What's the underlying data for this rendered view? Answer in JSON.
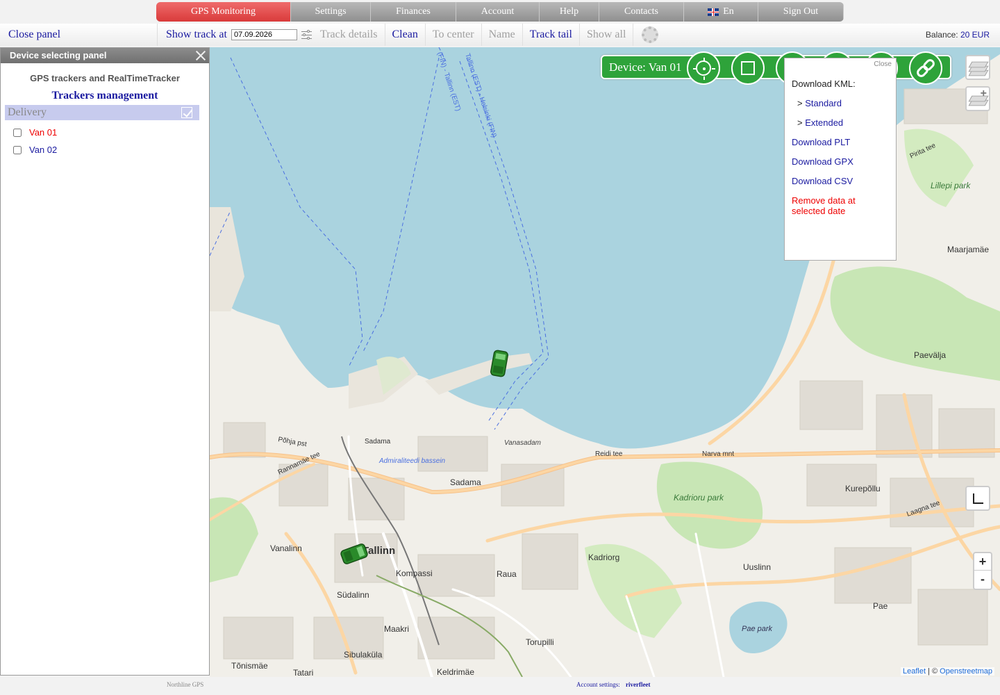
{
  "nav": {
    "items": [
      {
        "label": "GPS Monitoring",
        "active": true
      },
      {
        "label": "Settings"
      },
      {
        "label": "Finances"
      },
      {
        "label": "Account"
      },
      {
        "label": "Help"
      },
      {
        "label": "Contacts"
      },
      {
        "label": "En",
        "icon": "uk-flag-icon"
      },
      {
        "label": "Sign Out"
      }
    ]
  },
  "toolbar": {
    "close_panel": "Close panel",
    "show_track_label": "Show track at",
    "date_value": "07.09.2026",
    "track_details": "Track details",
    "clean": "Clean",
    "to_center": "To center",
    "name": "Name",
    "track_tail": "Track tail",
    "show_all": "Show all",
    "balance_label": "Balance:",
    "balance_value": "20 EUR"
  },
  "panel": {
    "header": "Device selecting panel",
    "subtitle": "GPS trackers and RealTimeTracker",
    "management_link": "Trackers management",
    "group": {
      "name": "Delivery",
      "checked": true
    },
    "devices": [
      {
        "name": "Van 01",
        "checked": false,
        "color": "#e00000"
      },
      {
        "name": "Van 02",
        "checked": false,
        "color": "#1a1aa0"
      }
    ]
  },
  "device_bar": {
    "title": "Device: Van 01",
    "buttons": [
      "locate-icon",
      "stop-square-icon",
      "circle-button",
      "circle-button",
      "circle-button",
      "link-icon"
    ]
  },
  "popup": {
    "close": "Close",
    "kml_title": "Download KML:",
    "kml_standard_prefix": ">",
    "kml_standard": "Standard",
    "kml_extended_prefix": ">",
    "kml_extended": "Extended",
    "plt": "Download PLT",
    "gpx": "Download GPX",
    "csv": "Download CSV",
    "remove": "Remove data at selected date"
  },
  "map": {
    "labels": {
      "tallinn": "Tallinn",
      "sadama": "Sadama",
      "sadama_street": "Sadama",
      "kadriorg": "Kadriorg",
      "kadrioru_park": "Kadrioru park",
      "kompassi": "Kompassi",
      "raua": "Raua",
      "sudalinn": "Südalinn",
      "maakri": "Maakri",
      "sibulakula": "Sibulaküla",
      "tonismae": "Tõnismäe",
      "tatari": "Tatari",
      "keldrimae": "Keldrimäe",
      "torupilli": "Torupilli",
      "uuslinn": "Uuslinn",
      "pae": "Pae",
      "pae_park": "Pae park",
      "kurepollu": "Kurepõllu",
      "paevalja": "Paevälja",
      "maarjamae": "Maarjamäe",
      "lillepi_park": "Lillepi park",
      "vanalinn": "Vanalinn",
      "vanasadam": "Vanasadam",
      "admiraliteedi": "Admiraliteedi bassein",
      "reidi_tee": "Reidi tee",
      "narva_mnt": "Narva mnt",
      "pirita_tee": "Pirita tee",
      "laagna_tee": "Laagna tee",
      "pohja_pst": "Põhja pst",
      "rannamae_tee": "Rannamäe tee",
      "ferry_route": "Tallinn (EST) - Helsinki (FIN)",
      "ferry_route2": "(FIN) - Tallinn (EST)"
    },
    "markers": [
      {
        "name": "Van 01",
        "color": "#2a8a2a"
      },
      {
        "name": "Van 02",
        "color": "#2a8a2a"
      }
    ],
    "attribution": {
      "leaflet": "Leaflet",
      "sep": " | © ",
      "osm": "Openstreetmap"
    },
    "zoom_in": "+",
    "zoom_out": "-"
  },
  "footer": {
    "brand": "Northline GPS",
    "account_settings": "Account settings:",
    "account_name": "riverfleet"
  }
}
